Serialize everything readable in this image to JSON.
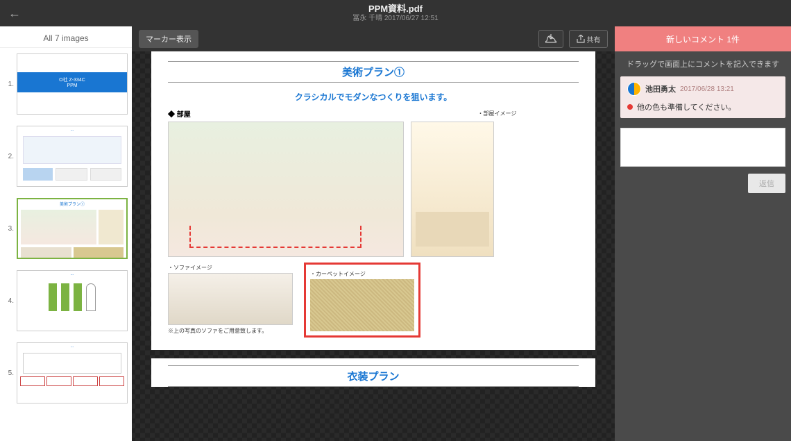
{
  "header": {
    "doc_title": "PPM資料.pdf",
    "doc_author": "冨永 千晴",
    "doc_timestamp": "2017/06/27 12:51"
  },
  "sidebar": {
    "title": "All 7 images",
    "thumbs": [
      {
        "num": "1.",
        "line1": "O社 Z-334C",
        "line2": "PPM"
      },
      {
        "num": "2."
      },
      {
        "num": "3."
      },
      {
        "num": "4."
      },
      {
        "num": "5."
      }
    ]
  },
  "toolbar": {
    "marker_label": "マーカー表示",
    "share_label": "共有"
  },
  "page": {
    "title": "美術プラン①",
    "subtitle": "クラシカルでモダンなつくりを狙います。",
    "room_label": "◆ 部屋",
    "room_image_label": "・部屋イメージ",
    "sofa_label": "・ソファイメージ",
    "sofa_note": "※上の写真のソファをご用意致します。",
    "carpet_label": "・カーペットイメージ",
    "next_title": "衣装プラン"
  },
  "comments": {
    "new_bar": "新しいコメント 1件",
    "drag_hint": "ドラッグで画面上にコメントを記入できます",
    "items": [
      {
        "author": "池田勇太",
        "time": "2017/06/28 13:21",
        "body": "他の色も準備してください。"
      }
    ],
    "reply_btn": "返信"
  }
}
